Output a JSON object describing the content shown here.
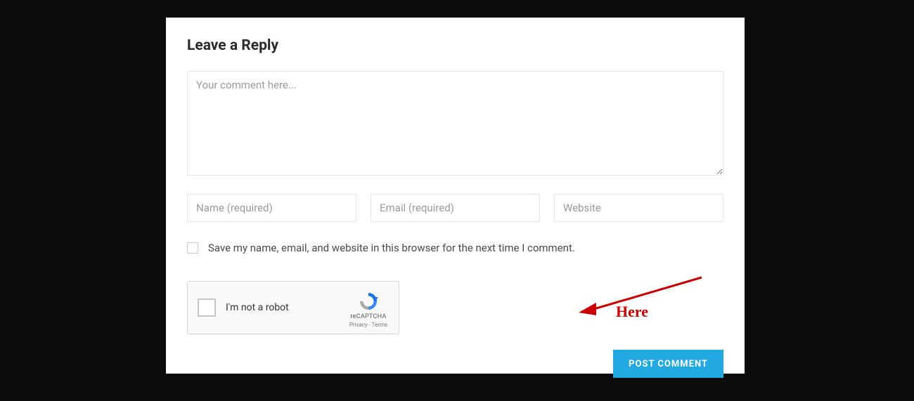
{
  "heading": "Leave a Reply",
  "comment": {
    "placeholder": "Your comment here...",
    "value": ""
  },
  "fields": {
    "name": {
      "placeholder": "Name (required)",
      "value": ""
    },
    "email": {
      "placeholder": "Email (required)",
      "value": ""
    },
    "website": {
      "placeholder": "Website",
      "value": ""
    }
  },
  "save_checkbox": {
    "checked": false,
    "label": "Save my name, email, and website in this browser for the next time I comment."
  },
  "recaptcha": {
    "checked": false,
    "label": "I'm not a robot",
    "brand": "reCAPTCHA",
    "links": "Privacy - Terms"
  },
  "submit_label": "POST COMMENT",
  "annotation": {
    "text": "Here",
    "color": "#cc0000"
  }
}
